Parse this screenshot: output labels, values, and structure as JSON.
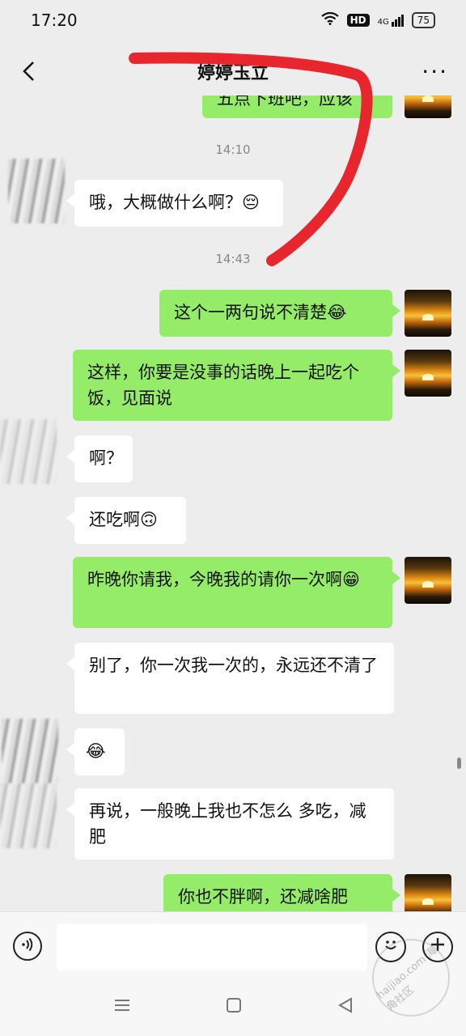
{
  "status_bar": {
    "time": "17:20",
    "hd": "HD",
    "network": "4G",
    "battery": "75"
  },
  "header": {
    "title": "婷婷玉立",
    "back_icon": "chevron-left-icon",
    "more_icon": "more-dots-icon",
    "more_label": "···"
  },
  "messages": [
    {
      "side": "out",
      "text": "五点下班吧，应该"
    },
    {
      "type": "time",
      "text": "14:10"
    },
    {
      "side": "in",
      "text": "哦，大概做什么啊？😔"
    },
    {
      "type": "time",
      "text": "14:43"
    },
    {
      "side": "out",
      "text": "这个一两句说不清楚😂"
    },
    {
      "side": "out",
      "text": "这样，你要是没事的话晚上一起吃个饭，见面说"
    },
    {
      "side": "in",
      "text": "啊？"
    },
    {
      "side": "in",
      "text": "还吃啊🙃"
    },
    {
      "side": "out",
      "text": "昨晚你请我，今晚我的请你一次啊😁"
    },
    {
      "side": "in",
      "text": "别了，你一次我一次的，永远还不清了"
    },
    {
      "side": "in",
      "text": "😂"
    },
    {
      "side": "in",
      "text": "再说，一般晚上我也不怎么 多吃，减肥"
    },
    {
      "side": "out",
      "text": "你也不胖啊，还减啥肥"
    }
  ],
  "input_bar": {
    "placeholder": "",
    "voice_icon": "voice-icon",
    "emoji_icon": "emoji-icon",
    "plus_icon": "plus-icon"
  },
  "nav_bar": {
    "menu_icon": "menu-icon",
    "home_icon": "home-icon",
    "back_icon": "back-triangle-icon"
  },
  "watermark": {
    "text": "haijiao.com 海角社区"
  },
  "colors": {
    "outgoing_bubble": "#95ec69",
    "incoming_bubble": "#ffffff",
    "background": "#ededed",
    "annotation_stroke": "#e8262d"
  }
}
